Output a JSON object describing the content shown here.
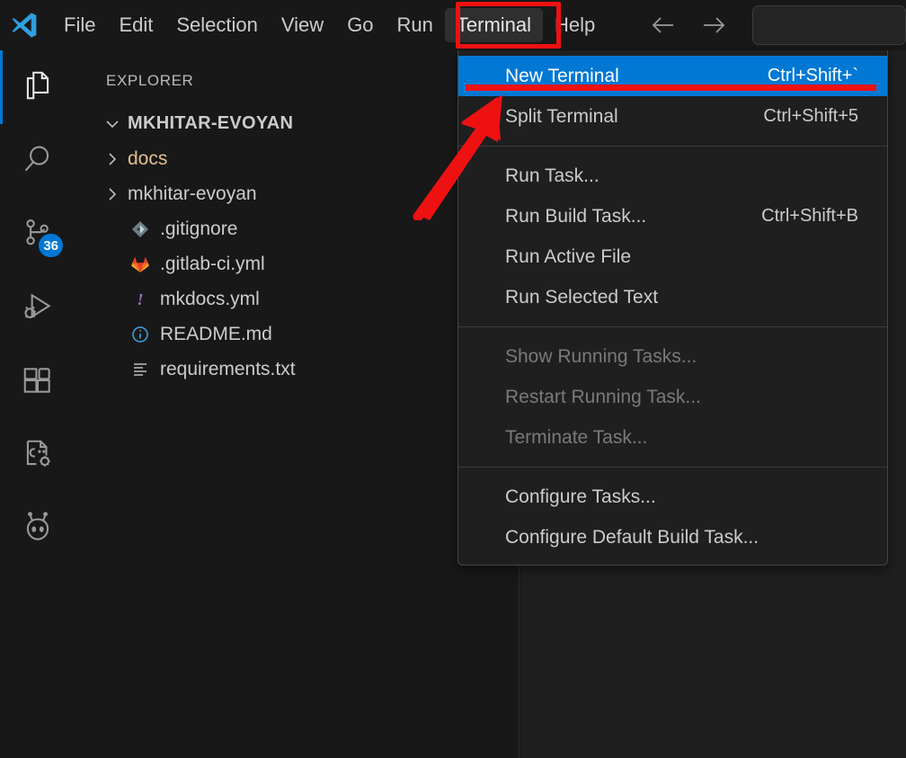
{
  "window": {
    "app": "Visual Studio Code",
    "logo_icon": "vscode-logo-icon"
  },
  "menubar": {
    "items": [
      {
        "label": "File",
        "name": "menu-file",
        "open": false
      },
      {
        "label": "Edit",
        "name": "menu-edit",
        "open": false
      },
      {
        "label": "Selection",
        "name": "menu-selection",
        "open": false
      },
      {
        "label": "View",
        "name": "menu-view",
        "open": false
      },
      {
        "label": "Go",
        "name": "menu-go",
        "open": false
      },
      {
        "label": "Run",
        "name": "menu-run",
        "open": false
      },
      {
        "label": "Terminal",
        "name": "menu-terminal",
        "open": true
      },
      {
        "label": "Help",
        "name": "menu-help",
        "open": false
      }
    ],
    "back_icon": "arrow-left-icon",
    "forward_icon": "arrow-right-icon",
    "command_center_placeholder": ""
  },
  "activitybar": {
    "items": [
      {
        "label": "Explorer",
        "icon": "files-icon",
        "active": true,
        "badge": ""
      },
      {
        "label": "Search",
        "icon": "search-icon",
        "active": false,
        "badge": ""
      },
      {
        "label": "Source Control",
        "icon": "source-control-icon",
        "active": false,
        "badge": "36"
      },
      {
        "label": "Run and Debug",
        "icon": "run-debug-icon",
        "active": false,
        "badge": ""
      },
      {
        "label": "Extensions",
        "icon": "extensions-icon",
        "active": false,
        "badge": ""
      },
      {
        "label": "C/C++ Configuration",
        "icon": "cpp-gear-icon",
        "active": false,
        "badge": ""
      },
      {
        "label": "Remote Explorer",
        "icon": "alien-icon",
        "active": false,
        "badge": ""
      }
    ]
  },
  "sidebar": {
    "title": "EXPLORER",
    "root": {
      "label": "MKHITAR-EVOYAN",
      "expanded": true,
      "twisty_icon": "chevron-down-icon"
    },
    "items": [
      {
        "label": "docs",
        "type": "folder",
        "icon": "chevron-right-icon",
        "modified": true
      },
      {
        "label": "mkhitar-evoyan",
        "type": "folder",
        "icon": "chevron-right-icon",
        "modified": false
      },
      {
        "label": ".gitignore",
        "type": "file",
        "icon": "git-icon",
        "modified": false
      },
      {
        "label": ".gitlab-ci.yml",
        "type": "file",
        "icon": "gitlab-icon",
        "modified": false
      },
      {
        "label": "mkdocs.yml",
        "type": "file",
        "icon": "exclamation-icon",
        "modified": false
      },
      {
        "label": "README.md",
        "type": "file",
        "icon": "info-circle-icon",
        "modified": false
      },
      {
        "label": "requirements.txt",
        "type": "file",
        "icon": "text-lines-icon",
        "modified": false
      }
    ]
  },
  "terminal_menu": {
    "rows": [
      {
        "kind": "item",
        "label": "New Terminal",
        "shortcut": "Ctrl+Shift+`",
        "state": "highlight",
        "name": "menu-new-terminal"
      },
      {
        "kind": "item",
        "label": "Split Terminal",
        "shortcut": "Ctrl+Shift+5",
        "state": "normal",
        "name": "menu-split-terminal"
      },
      {
        "kind": "sep"
      },
      {
        "kind": "item",
        "label": "Run Task...",
        "shortcut": "",
        "state": "normal",
        "name": "menu-run-task"
      },
      {
        "kind": "item",
        "label": "Run Build Task...",
        "shortcut": "Ctrl+Shift+B",
        "state": "normal",
        "name": "menu-run-build-task"
      },
      {
        "kind": "item",
        "label": "Run Active File",
        "shortcut": "",
        "state": "normal",
        "name": "menu-run-active-file"
      },
      {
        "kind": "item",
        "label": "Run Selected Text",
        "shortcut": "",
        "state": "normal",
        "name": "menu-run-selected-text"
      },
      {
        "kind": "sep"
      },
      {
        "kind": "item",
        "label": "Show Running Tasks...",
        "shortcut": "",
        "state": "disabled",
        "name": "menu-show-running-tasks"
      },
      {
        "kind": "item",
        "label": "Restart Running Task...",
        "shortcut": "",
        "state": "disabled",
        "name": "menu-restart-running-task"
      },
      {
        "kind": "item",
        "label": "Terminate Task...",
        "shortcut": "",
        "state": "disabled",
        "name": "menu-terminate-task"
      },
      {
        "kind": "sep"
      },
      {
        "kind": "item",
        "label": "Configure Tasks...",
        "shortcut": "",
        "state": "normal",
        "name": "menu-configure-tasks"
      },
      {
        "kind": "item",
        "label": "Configure Default Build Task...",
        "shortcut": "",
        "state": "normal",
        "name": "menu-configure-default-build-task"
      }
    ]
  },
  "annotations": {
    "color": "#ee1111",
    "box_target": "Terminal",
    "underline_target": "New Terminal",
    "arrow_target": "New Terminal"
  },
  "colors": {
    "accent": "#0078d4",
    "annotation_red": "#ee1111",
    "background": "#181818",
    "editor_background": "#1f1f1f",
    "menu_background": "#1f1f1f",
    "modified_file": "#e2c08d"
  }
}
